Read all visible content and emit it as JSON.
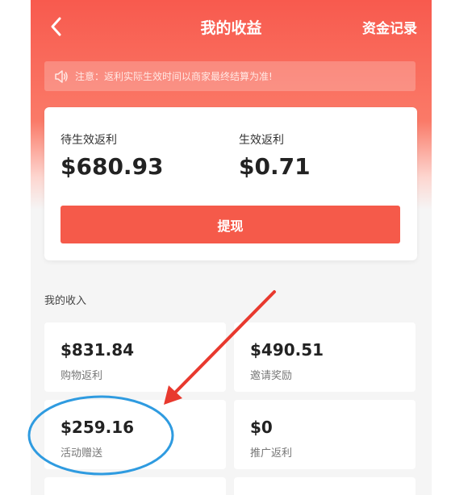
{
  "header": {
    "title": "我的收益",
    "action_label": "资金记录"
  },
  "notice": {
    "text": "注意：返利实际生效时间以商家最终结算为准!"
  },
  "summary": {
    "pending_label": "待生效返利",
    "pending_value": "$680.93",
    "effective_label": "生效返利",
    "effective_value": "$0.71",
    "withdraw_label": "提现"
  },
  "income": {
    "title": "我的收入",
    "items": [
      {
        "value": "$831.84",
        "label": "购物返利"
      },
      {
        "value": "$490.51",
        "label": "邀请奖励"
      },
      {
        "value": "$259.16",
        "label": "活动赠送"
      },
      {
        "value": "$0",
        "label": "推广返利"
      }
    ]
  },
  "colors": {
    "brand": "#f55a4a",
    "annotation_arrow": "#e8392e",
    "annotation_circle": "#2f9be0"
  }
}
